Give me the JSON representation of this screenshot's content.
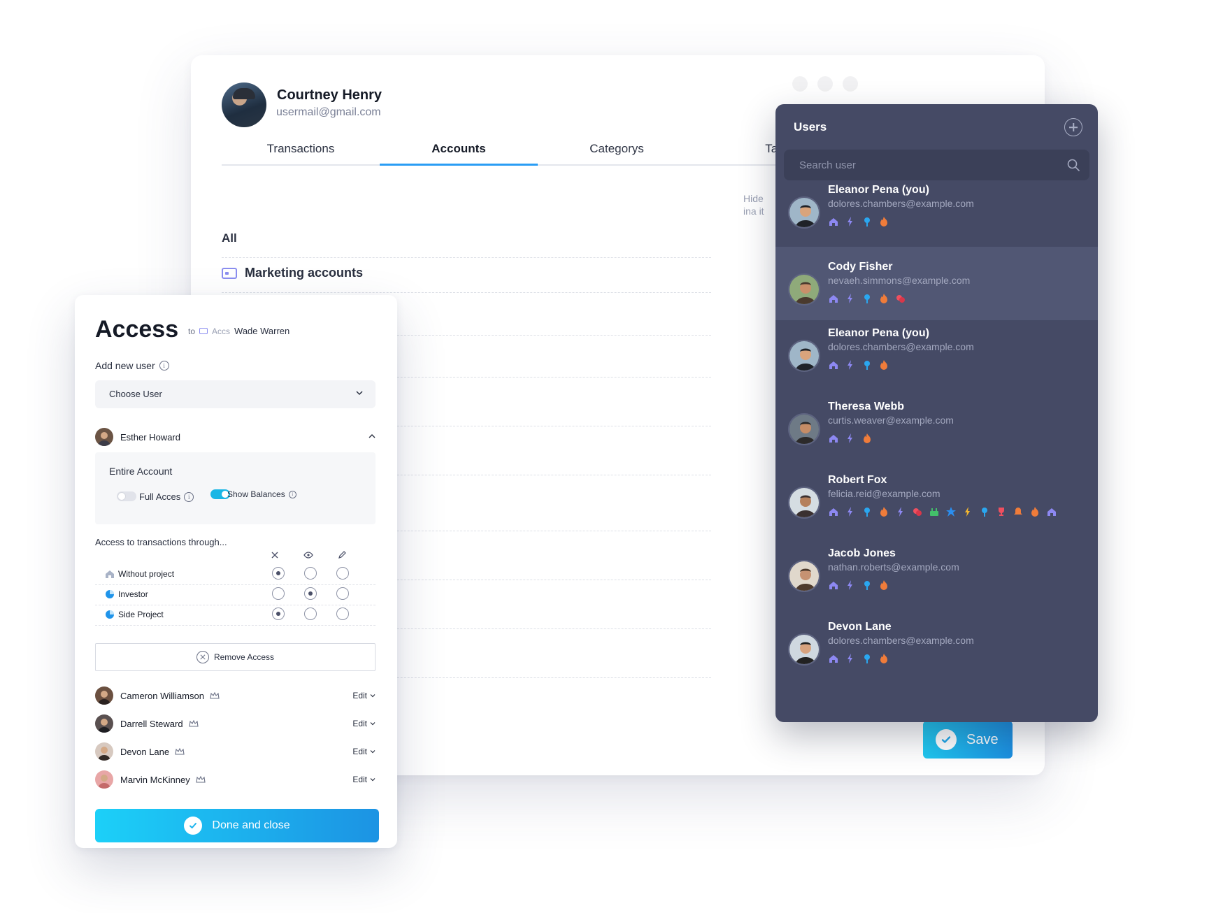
{
  "profile": {
    "name": "Courtney Henry",
    "email": "usermail@gmail.com"
  },
  "tabs": [
    {
      "label": "Transactions",
      "active": false
    },
    {
      "label": "Accounts",
      "active": true
    },
    {
      "label": "Categorys",
      "active": false
    },
    {
      "label": "Tag",
      "active": false
    }
  ],
  "main": {
    "hide_text": "Hide ina it",
    "all_label": "All",
    "marketing_label": "Marketing accounts",
    "save_label": "Save"
  },
  "users_panel": {
    "title": "Users",
    "add_icon": "plus-circle-icon",
    "search_placeholder": "Search user",
    "users": [
      {
        "name": "Eleanor Pena (you)",
        "email": "dolores.chambers@example.com",
        "selected": false,
        "icons": [
          "home",
          "bolt",
          "pin",
          "fire"
        ]
      },
      {
        "name": "Cody Fisher",
        "email": "nevaeh.simmons@example.com",
        "selected": true,
        "icons": [
          "home",
          "bolt",
          "pin",
          "fire",
          "coins"
        ]
      },
      {
        "name": "Eleanor Pena (you)",
        "email": "dolores.chambers@example.com",
        "selected": false,
        "icons": [
          "home",
          "bolt",
          "pin",
          "fire"
        ]
      },
      {
        "name": "Theresa Webb",
        "email": "curtis.weaver@example.com",
        "selected": false,
        "icons": [
          "home",
          "bolt",
          "fire"
        ]
      },
      {
        "name": "Robert Fox",
        "email": "felicia.reid@example.com",
        "selected": false,
        "icons": [
          "home",
          "bolt",
          "pin",
          "fire",
          "bolt",
          "coins",
          "cake",
          "star",
          "flash",
          "pin",
          "trophy",
          "bell",
          "fire",
          "home"
        ]
      },
      {
        "name": "Jacob Jones",
        "email": "nathan.roberts@example.com",
        "selected": false,
        "icons": [
          "home",
          "bolt",
          "pin",
          "fire"
        ]
      },
      {
        "name": "Devon Lane",
        "email": "dolores.chambers@example.com",
        "selected": false,
        "icons": [
          "home",
          "bolt",
          "pin",
          "fire"
        ]
      }
    ]
  },
  "access": {
    "title": "Access",
    "to_label": "to",
    "account_short": "Accs",
    "account_owner": "Wade Warren",
    "add_new_user_label": "Add new user",
    "choose_user_placeholder": "Choose User",
    "expanded_user": "Esther Howard",
    "entire_account_label": "Entire Account",
    "full_access_label": "Full Acces",
    "full_access_on": false,
    "show_balances_label": "Show Balances",
    "show_balances_on": true,
    "through_label": "Access to transactions through...",
    "columns": [
      "no-access-icon",
      "view-icon",
      "edit-icon"
    ],
    "projects": [
      {
        "name": "Without project",
        "icon": "home",
        "selected": 0
      },
      {
        "name": "Investor",
        "icon": "pie",
        "selected": 1
      },
      {
        "name": "Side Project",
        "icon": "pie",
        "selected": 0
      }
    ],
    "remove_label": "Remove Access",
    "members": [
      {
        "name": "Cameron Williamson",
        "edit": "Edit"
      },
      {
        "name": "Darrell Steward",
        "edit": "Edit"
      },
      {
        "name": "Devon Lane",
        "edit": "Edit"
      },
      {
        "name": "Marvin McKinney",
        "edit": "Edit"
      }
    ],
    "done_label": "Done and close"
  },
  "colors": {
    "accent": "#2a9df4",
    "panel": "#454a65",
    "panel_selected": "#515774",
    "button_gradient_start": "#1cd0f8",
    "button_gradient_end": "#1c93e3"
  }
}
